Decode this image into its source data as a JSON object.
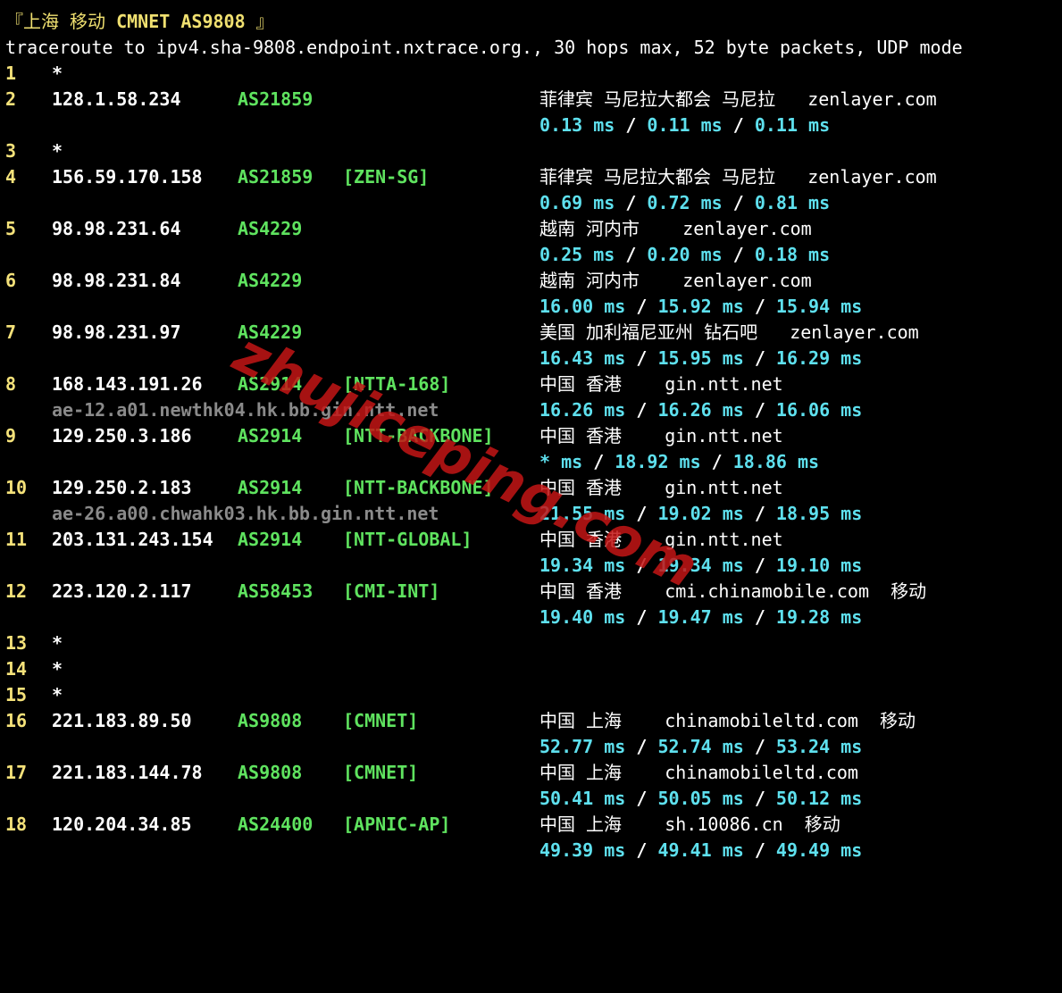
{
  "title": {
    "open": "『",
    "city": "上海",
    "carrier": "移动",
    "net": "CMNET",
    "asn": "AS9808",
    "close": "』"
  },
  "trace_header": "traceroute to ipv4.sha-9808.endpoint.nxtrace.org., 30 hops max, 52 byte packets, UDP mode",
  "watermark": "zhujiceping.com",
  "colors": {
    "background": "#000000",
    "hop": "#f5e27a",
    "asn": "#5fe35f",
    "rtt": "#5ee0ee",
    "rdns": "#8a8a8a",
    "watermark": "#c41616"
  },
  "hops": {
    "h1": {
      "num": "1",
      "star": "*"
    },
    "h2": {
      "num": "2",
      "ip": "128.1.58.234",
      "asn": "AS21859",
      "tag": "",
      "geo": "菲律宾 马尼拉大都会 马尼拉   zenlayer.com",
      "rtt": [
        "0.13 ms",
        "0.11 ms",
        "0.11 ms"
      ]
    },
    "h3": {
      "num": "3",
      "star": "*"
    },
    "h4": {
      "num": "4",
      "ip": "156.59.170.158",
      "asn": "AS21859",
      "tag": "[ZEN-SG]",
      "geo": "菲律宾 马尼拉大都会 马尼拉   zenlayer.com",
      "rtt": [
        "0.69 ms",
        "0.72 ms",
        "0.81 ms"
      ]
    },
    "h5": {
      "num": "5",
      "ip": "98.98.231.64",
      "asn": "AS4229",
      "tag": "",
      "geo": "越南 河内市    zenlayer.com",
      "rtt": [
        "0.25 ms",
        "0.20 ms",
        "0.18 ms"
      ]
    },
    "h6": {
      "num": "6",
      "ip": "98.98.231.84",
      "asn": "AS4229",
      "tag": "",
      "geo": "越南 河内市    zenlayer.com",
      "rtt": [
        "16.00 ms",
        "15.92 ms",
        "15.94 ms"
      ]
    },
    "h7": {
      "num": "7",
      "ip": "98.98.231.97",
      "asn": "AS4229",
      "tag": "",
      "geo": "美国 加利福尼亚州 钻石吧   zenlayer.com",
      "rtt": [
        "16.43 ms",
        "15.95 ms",
        "16.29 ms"
      ]
    },
    "h8": {
      "num": "8",
      "ip": "168.143.191.26",
      "asn": "AS2914",
      "tag": "[NTTA-168]",
      "geo": "中国 香港    gin.ntt.net",
      "rdns": "ae-12.a01.newthk04.hk.bb.gin.ntt.net",
      "rtt": [
        "16.26 ms",
        "16.26 ms",
        "16.06 ms"
      ]
    },
    "h9": {
      "num": "9",
      "ip": "129.250.3.186",
      "asn": "AS2914",
      "tag": "[NTT-BACKBONE]",
      "geo": "中国 香港    gin.ntt.net",
      "rtt": [
        "* ms",
        "18.92 ms",
        "18.86 ms"
      ]
    },
    "h10": {
      "num": "10",
      "ip": "129.250.2.183",
      "asn": "AS2914",
      "tag": "[NTT-BACKBONE]",
      "geo": "中国 香港    gin.ntt.net",
      "rdns": "ae-26.a00.chwahk03.hk.bb.gin.ntt.net",
      "rtt": [
        "21.55 ms",
        "19.02 ms",
        "18.95 ms"
      ]
    },
    "h11": {
      "num": "11",
      "ip": "203.131.243.154",
      "asn": "AS2914",
      "tag": "[NTT-GLOBAL]",
      "geo": "中国 香港    gin.ntt.net",
      "rtt": [
        "19.34 ms",
        "19.34 ms",
        "19.10 ms"
      ]
    },
    "h12": {
      "num": "12",
      "ip": "223.120.2.117",
      "asn": "AS58453",
      "tag": "[CMI-INT]",
      "geo": "中国 香港    cmi.chinamobile.com  移动",
      "rtt": [
        "19.40 ms",
        "19.47 ms",
        "19.28 ms"
      ]
    },
    "h13": {
      "num": "13",
      "star": "*"
    },
    "h14": {
      "num": "14",
      "star": "*"
    },
    "h15": {
      "num": "15",
      "star": "*"
    },
    "h16": {
      "num": "16",
      "ip": "221.183.89.50",
      "asn": "AS9808",
      "tag": "[CMNET]",
      "geo": "中国 上海    chinamobileltd.com  移动",
      "rtt": [
        "52.77 ms",
        "52.74 ms",
        "53.24 ms"
      ]
    },
    "h17": {
      "num": "17",
      "ip": "221.183.144.78",
      "asn": "AS9808",
      "tag": "[CMNET]",
      "geo": "中国 上海    chinamobileltd.com",
      "rtt": [
        "50.41 ms",
        "50.05 ms",
        "50.12 ms"
      ]
    },
    "h18": {
      "num": "18",
      "ip": "120.204.34.85",
      "asn": "AS24400",
      "tag": "[APNIC-AP]",
      "geo": "中国 上海    sh.10086.cn  移动",
      "rtt": [
        "49.39 ms",
        "49.41 ms",
        "49.49 ms"
      ]
    }
  }
}
